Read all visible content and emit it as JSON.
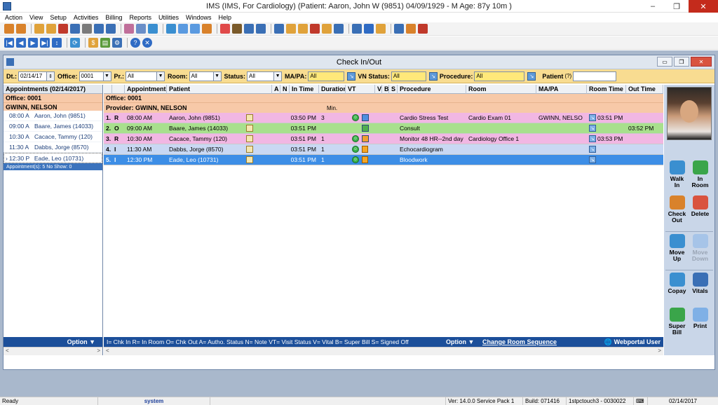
{
  "window": {
    "title": "IMS (IMS, For Cardiology)     (Patient: Aaron, John W (9851) 04/09/1929 - M Age: 87y 10m )",
    "controls": [
      "–",
      "❐",
      "✕"
    ]
  },
  "menu": [
    "Action",
    "View",
    "Setup",
    "Activities",
    "Billing",
    "Reports",
    "Utilities",
    "Windows",
    "Help"
  ],
  "toolbar1_colors": [
    "#d9822b",
    "#d9822b",
    "#e0a23a",
    "#e0a23a",
    "#c0392b",
    "#3a6fb5",
    "#7a7a7a",
    "#3a6fb5",
    "#3a6fb5",
    "#c06f9a",
    "#6a8fc8",
    "#3a8fd0",
    "#3a8fd0",
    "#5a9ae0",
    "#5a9ae0",
    "#d9822b",
    "#e04a4a",
    "#7a5a2a",
    "#3a6fb5",
    "#3a6fb5",
    "#3a6fb5",
    "#e0a23a",
    "#e0a23a",
    "#c0392b",
    "#e0a23a",
    "#3a6fb5",
    "#3a6fb5",
    "#2f6bc4",
    "#e0a23a",
    "#3a6fb5",
    "#d9822b",
    "#c0392b"
  ],
  "toolbar2_colors": [
    "#2f6bc4",
    "#2f6bc4",
    "#2f6bc4",
    "#2f6bc4",
    "#2f6bc4",
    "#3a8fd0",
    "#e0a23a",
    "#5a9a3a",
    "#3a6fb5",
    "#2f6bc4",
    "#2f6bc4"
  ],
  "child": {
    "title": "Check In/Out",
    "controls": [
      "▭",
      "❐",
      "✕"
    ]
  },
  "filters": {
    "dt_label": "Dt.:",
    "dt_value": "02/14/17",
    "office_label": "Office:",
    "office_value": "0001",
    "pr_label": "Pr.:",
    "pr_value": "All",
    "room_label": "Room:",
    "room_value": "All",
    "status_label": "Status:",
    "status_value": "All",
    "mapa_label": "MA/PA:",
    "mapa_value": "All",
    "vnstatus_label": "VN Status:",
    "vnstatus_value": "All",
    "procedure_label": "Procedure:",
    "procedure_value": "All",
    "patient_label": "Patient",
    "patient_hint": "(?)",
    "patient_value": ""
  },
  "left": {
    "header": "Appointments (02/14/2017)",
    "office": "Office: 0001",
    "provider": "GWINN, NELSON",
    "items": [
      {
        "time": "08:00 A",
        "name": "Aaron, John  (9851)"
      },
      {
        "time": "09:00 A",
        "name": "Baare, James  (14033)"
      },
      {
        "time": "10:30 A",
        "name": "Cacace, Tammy  (120)"
      },
      {
        "time": "11:30 A",
        "name": "Dabbs, Jorge  (8570)"
      },
      {
        "time": "12:30 P",
        "name": "Eade, Leo  (10731)"
      }
    ],
    "footer": "Appointment(s): 5    No Show: 0",
    "option": "Option ▼"
  },
  "grid": {
    "headers": [
      "",
      "",
      "Appointment",
      "Patient",
      "A",
      "N",
      "In Time",
      "Duration",
      "VT",
      "V",
      "B",
      "S",
      "Procedure",
      "Room",
      "MA/PA",
      "Room Time",
      "Out Time"
    ],
    "office": "Office: 0001",
    "provider": "Provider: GWINN, NELSON",
    "min_label": "Min.",
    "rows": [
      {
        "num": "1.",
        "st": "R",
        "appt": "08:00 AM",
        "patient": "Aaron, John  (9851)",
        "in_time": "03:50 PM",
        "duration": "3",
        "proc": "Cardio Stress Test",
        "room": "Cardio Exam 01",
        "mapa": "GWINN, NELSO",
        "room_time": "03:51 PM",
        "out_time": "",
        "bg": "#f1b7e3",
        "vt": "smile",
        "vcolor": "#4f8fe0"
      },
      {
        "num": "2.",
        "st": "O",
        "appt": "09:00 AM",
        "patient": "Baare, James  (14033)",
        "in_time": "03:51 PM",
        "duration": "",
        "proc": "Consult",
        "room": "",
        "mapa": "",
        "room_time": "",
        "out_time": "03:52 PM",
        "bg": "#a8e08d",
        "vt": "none",
        "vcolor": "#4fae4f"
      },
      {
        "num": "3.",
        "st": "R",
        "appt": "10:30 AM",
        "patient": "Cacace, Tammy  (120)",
        "in_time": "03:51 PM",
        "duration": "1",
        "proc": "Monitor 48 HR--2nd day",
        "room": "Cardiology Office 1",
        "mapa": "",
        "room_time": "03:53 PM",
        "out_time": "",
        "bg": "#f1b7e3",
        "vt": "smile",
        "vcolor": "#f0a030"
      },
      {
        "num": "4.",
        "st": "I",
        "appt": "11:30 AM",
        "patient": "Dabbs, Jorge  (8570)",
        "in_time": "03:51 PM",
        "duration": "1",
        "proc": "Echocardiogram",
        "room": "",
        "mapa": "",
        "room_time": "",
        "out_time": "",
        "bg": "#c9d8f3",
        "vt": "smile-doc",
        "vcolor": ""
      },
      {
        "num": "5.",
        "st": "I",
        "appt": "12:30 PM",
        "patient": "Eade, Leo  (10731)",
        "in_time": "03:51 PM",
        "duration": "1",
        "proc": "Bloodwork",
        "room": "",
        "mapa": "",
        "room_time": "",
        "out_time": "",
        "bg": "#3d8ee6",
        "vt": "smile-doc",
        "vcolor": ""
      }
    ],
    "legend": "I= Chk In  R= In Room O= Chk Out  A= Autho. Status  N= Note  VT= Visit Status  V= Vital  B= Super Bill  S= Signed Off",
    "option": "Option ▼",
    "change_room": "Change Room Sequence",
    "webportal": "Webportal User"
  },
  "actions": [
    {
      "label1": "Walk",
      "label2": "In",
      "color": "#3a8fd0",
      "disabled": false
    },
    {
      "label1": "In",
      "label2": "Room",
      "color": "#3aa54a",
      "disabled": false
    },
    {
      "label1": "Check",
      "label2": "Out",
      "color": "#d9822b",
      "disabled": false
    },
    {
      "label1": "Delete",
      "label2": "",
      "color": "#d9533f",
      "disabled": false
    },
    {
      "label1": "Move",
      "label2": "Up",
      "color": "#3a8fd0",
      "disabled": false
    },
    {
      "label1": "Move",
      "label2": "Down",
      "color": "#a6c4e8",
      "disabled": true
    },
    {
      "label1": "Copay",
      "label2": "",
      "color": "#3a8fd0",
      "disabled": false
    },
    {
      "label1": "Vitals",
      "label2": "",
      "color": "#3a6fb5",
      "disabled": false
    },
    {
      "label1": "Super",
      "label2": "Bill",
      "color": "#3aa54a",
      "disabled": false
    },
    {
      "label1": "Print",
      "label2": "",
      "color": "#7fb0e6",
      "disabled": false
    }
  ],
  "status": {
    "ready": "Ready",
    "user": "system",
    "version": "Ver: 14.0.0 Service Pack 1",
    "build": "Build: 071416",
    "station": "1stpctouch3 - 0030022",
    "date": "02/14/2017"
  }
}
